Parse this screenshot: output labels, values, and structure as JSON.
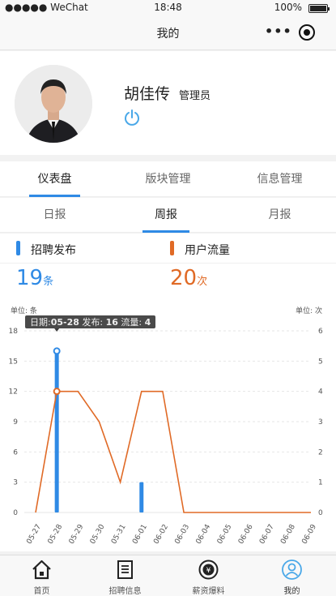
{
  "status_bar": {
    "carrier": "●●●●● WeChat",
    "time": "18:48",
    "battery": "100%"
  },
  "nav": {
    "title": "我的"
  },
  "profile": {
    "name": "胡佳传",
    "role": "管理员"
  },
  "main_tabs": [
    {
      "label": "仪表盘",
      "active": true
    },
    {
      "label": "版块管理",
      "active": false
    },
    {
      "label": "信息管理",
      "active": false
    }
  ],
  "sub_tabs": [
    {
      "label": "日报",
      "active": false
    },
    {
      "label": "周报",
      "active": true
    },
    {
      "label": "月报",
      "active": false
    }
  ],
  "stats": {
    "recruit": {
      "label": "招聘发布",
      "value": "19",
      "unit": "条",
      "color": "#2f8ae5"
    },
    "traffic": {
      "label": "用户流量",
      "value": "20",
      "unit": "次",
      "color": "#e06a26"
    }
  },
  "chart_data": {
    "type": "bar",
    "categories": [
      "05-27",
      "05-28",
      "05-29",
      "05-30",
      "05-31",
      "06-01",
      "06-02",
      "06-03",
      "06-04",
      "06-05",
      "06-06",
      "06-07",
      "06-08",
      "06-09"
    ],
    "series": [
      {
        "name": "发布",
        "type": "bar",
        "axis": "left",
        "color": "#2f8ae5",
        "values": [
          0,
          16,
          0,
          0,
          0,
          3,
          0,
          0,
          0,
          0,
          0,
          0,
          0,
          0
        ]
      },
      {
        "name": "流量",
        "type": "line",
        "axis": "right",
        "color": "#e06a26",
        "values": [
          0,
          4,
          4,
          3,
          1,
          4,
          4,
          0,
          0,
          0,
          0,
          0,
          0,
          0
        ]
      }
    ],
    "left_axis": {
      "unit_label": "单位: 条",
      "ticks": [
        0,
        3,
        6,
        9,
        12,
        15,
        18
      ],
      "ylim": [
        0,
        18
      ]
    },
    "right_axis": {
      "unit_label": "单位: 次",
      "ticks": [
        0,
        1,
        2,
        3,
        4,
        5,
        6
      ],
      "ylim": [
        0,
        6
      ]
    },
    "tooltip": {
      "date_label": "日期:",
      "date": "05-28",
      "pub_label": "发布:",
      "pub": "16",
      "flow_label": "流量:",
      "flow": "4",
      "index": 1
    }
  },
  "tabbar": [
    {
      "label": "首页",
      "icon": "home-icon",
      "active": false
    },
    {
      "label": "招聘信息",
      "icon": "document-icon",
      "active": false
    },
    {
      "label": "薪资爆料",
      "icon": "money-icon",
      "active": false
    },
    {
      "label": "我的",
      "icon": "user-icon",
      "active": true
    }
  ]
}
